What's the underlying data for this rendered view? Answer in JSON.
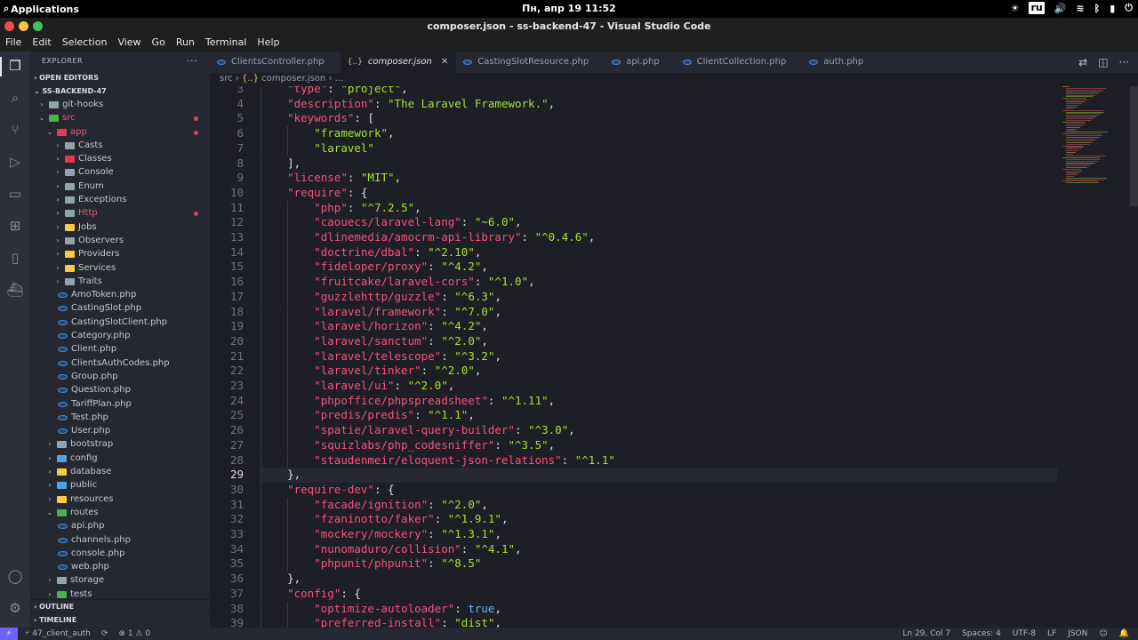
{
  "system": {
    "activities_label": "Applications",
    "clock": "Пн, апр 19  11:52",
    "keyboard_layout": "ru"
  },
  "window": {
    "title": "composer.json - ss-backend-47 - Visual Studio Code"
  },
  "menu": [
    "File",
    "Edit",
    "Selection",
    "View",
    "Go",
    "Run",
    "Terminal",
    "Help"
  ],
  "sidebar": {
    "title": "EXPLORER",
    "more": "···",
    "open_editors": "OPEN EDITORS",
    "project": "SS-BACKEND-47",
    "outline": "OUTLINE",
    "timeline": "TIMELINE",
    "tree": [
      {
        "label": "git-hooks",
        "depth": 0,
        "type": "folder",
        "open": false,
        "color": "#90a4ae"
      },
      {
        "label": "src",
        "depth": 0,
        "type": "folder",
        "open": true,
        "color": "#4caf50",
        "modified": true,
        "red": true
      },
      {
        "label": "app",
        "depth": 1,
        "type": "folder",
        "open": true,
        "color": "#e53950",
        "modified": true,
        "red": true
      },
      {
        "label": "Casts",
        "depth": 2,
        "type": "folder",
        "open": false,
        "color": "#90a4ae"
      },
      {
        "label": "Classes",
        "depth": 2,
        "type": "folder",
        "open": false,
        "color": "#e53950"
      },
      {
        "label": "Console",
        "depth": 2,
        "type": "folder",
        "open": false,
        "color": "#90a4ae"
      },
      {
        "label": "Enum",
        "depth": 2,
        "type": "folder",
        "open": false,
        "color": "#90a4ae"
      },
      {
        "label": "Exceptions",
        "depth": 2,
        "type": "folder",
        "open": false,
        "color": "#90a4ae"
      },
      {
        "label": "Http",
        "depth": 2,
        "type": "folder",
        "open": false,
        "color": "#90a4ae",
        "modified": true,
        "red": true
      },
      {
        "label": "Jobs",
        "depth": 2,
        "type": "folder",
        "open": false,
        "color": "#f9c846"
      },
      {
        "label": "Observers",
        "depth": 2,
        "type": "folder",
        "open": false,
        "color": "#90a4ae"
      },
      {
        "label": "Providers",
        "depth": 2,
        "type": "folder",
        "open": false,
        "color": "#f9c846"
      },
      {
        "label": "Services",
        "depth": 2,
        "type": "folder",
        "open": false,
        "color": "#f9c846"
      },
      {
        "label": "Traits",
        "depth": 2,
        "type": "folder",
        "open": false,
        "color": "#90a4ae"
      },
      {
        "label": "AmoToken.php",
        "depth": 2,
        "type": "php"
      },
      {
        "label": "CastingSlot.php",
        "depth": 2,
        "type": "php"
      },
      {
        "label": "CastingSlotClient.php",
        "depth": 2,
        "type": "php"
      },
      {
        "label": "Category.php",
        "depth": 2,
        "type": "php"
      },
      {
        "label": "Client.php",
        "depth": 2,
        "type": "php"
      },
      {
        "label": "ClientsAuthCodes.php",
        "depth": 2,
        "type": "php"
      },
      {
        "label": "Group.php",
        "depth": 2,
        "type": "php"
      },
      {
        "label": "Question.php",
        "depth": 2,
        "type": "php"
      },
      {
        "label": "TariffPlan.php",
        "depth": 2,
        "type": "php"
      },
      {
        "label": "Test.php",
        "depth": 2,
        "type": "php"
      },
      {
        "label": "User.php",
        "depth": 2,
        "type": "php"
      },
      {
        "label": "bootstrap",
        "depth": 1,
        "type": "folder",
        "open": false,
        "color": "#90a4ae"
      },
      {
        "label": "config",
        "depth": 1,
        "type": "folder",
        "open": false,
        "color": "#4fa3e0"
      },
      {
        "label": "database",
        "depth": 1,
        "type": "folder",
        "open": false,
        "color": "#f9c846"
      },
      {
        "label": "public",
        "depth": 1,
        "type": "folder",
        "open": false,
        "color": "#4fa3e0"
      },
      {
        "label": "resources",
        "depth": 1,
        "type": "folder",
        "open": false,
        "color": "#f9c846"
      },
      {
        "label": "routes",
        "depth": 1,
        "type": "folder",
        "open": true,
        "color": "#4caf50"
      },
      {
        "label": "api.php",
        "depth": 2,
        "type": "php"
      },
      {
        "label": "channels.php",
        "depth": 2,
        "type": "php"
      },
      {
        "label": "console.php",
        "depth": 2,
        "type": "php"
      },
      {
        "label": "web.php",
        "depth": 2,
        "type": "php"
      },
      {
        "label": "storage",
        "depth": 1,
        "type": "folder",
        "open": false,
        "color": "#90a4ae"
      },
      {
        "label": "tests",
        "depth": 1,
        "type": "folder",
        "open": false,
        "color": "#4caf50"
      }
    ]
  },
  "tabs": [
    {
      "label": "ClientsController.php",
      "kind": "php",
      "active": false
    },
    {
      "label": "composer.json",
      "kind": "json",
      "active": true
    },
    {
      "label": "CastingSlotResource.php",
      "kind": "php",
      "active": false
    },
    {
      "label": "api.php",
      "kind": "php",
      "active": false
    },
    {
      "label": "ClientCollection.php",
      "kind": "php",
      "active": false
    },
    {
      "label": "auth.php",
      "kind": "php",
      "active": false
    }
  ],
  "breadcrumb": {
    "folder": "src",
    "sep": "›",
    "json_icon": "{..}",
    "file": "composer.json",
    "more": "› ..."
  },
  "code": {
    "first_line": 3,
    "current_line": 29,
    "lines": [
      [
        [
          "i",
          4
        ],
        [
          "k",
          "\"type\""
        ],
        [
          "p",
          ": "
        ],
        [
          "s",
          "\"project\""
        ],
        [
          "p",
          ","
        ]
      ],
      [
        [
          "i",
          4
        ],
        [
          "k",
          "\"description\""
        ],
        [
          "p",
          ": "
        ],
        [
          "s",
          "\"The Laravel Framework.\""
        ],
        [
          "p",
          ","
        ]
      ],
      [
        [
          "i",
          4
        ],
        [
          "k",
          "\"keywords\""
        ],
        [
          "p",
          ": ["
        ]
      ],
      [
        [
          "i",
          8
        ],
        [
          "s",
          "\"framework\""
        ],
        [
          "p",
          ","
        ]
      ],
      [
        [
          "i",
          8
        ],
        [
          "s",
          "\"laravel\""
        ]
      ],
      [
        [
          "i",
          4
        ],
        [
          "p",
          "],"
        ]
      ],
      [
        [
          "i",
          4
        ],
        [
          "k",
          "\"license\""
        ],
        [
          "p",
          ": "
        ],
        [
          "s",
          "\"MIT\""
        ],
        [
          "p",
          ","
        ]
      ],
      [
        [
          "i",
          4
        ],
        [
          "k",
          "\"require\""
        ],
        [
          "p",
          ": {"
        ]
      ],
      [
        [
          "i",
          8
        ],
        [
          "k",
          "\"php\""
        ],
        [
          "p",
          ": "
        ],
        [
          "s",
          "\"^7.2.5\""
        ],
        [
          "p",
          ","
        ]
      ],
      [
        [
          "i",
          8
        ],
        [
          "k",
          "\"caouecs/laravel-lang\""
        ],
        [
          "p",
          ": "
        ],
        [
          "s",
          "\"~6.0\""
        ],
        [
          "p",
          ","
        ]
      ],
      [
        [
          "i",
          8
        ],
        [
          "k",
          "\"dlinemedia/amocrm-api-library\""
        ],
        [
          "p",
          ": "
        ],
        [
          "s",
          "\"^0.4.6\""
        ],
        [
          "p",
          ","
        ]
      ],
      [
        [
          "i",
          8
        ],
        [
          "k",
          "\"doctrine/dbal\""
        ],
        [
          "p",
          ": "
        ],
        [
          "s",
          "\"^2.10\""
        ],
        [
          "p",
          ","
        ]
      ],
      [
        [
          "i",
          8
        ],
        [
          "k",
          "\"fideloper/proxy\""
        ],
        [
          "p",
          ": "
        ],
        [
          "s",
          "\"^4.2\""
        ],
        [
          "p",
          ","
        ]
      ],
      [
        [
          "i",
          8
        ],
        [
          "k",
          "\"fruitcake/laravel-cors\""
        ],
        [
          "p",
          ": "
        ],
        [
          "s",
          "\"^1.0\""
        ],
        [
          "p",
          ","
        ]
      ],
      [
        [
          "i",
          8
        ],
        [
          "k",
          "\"guzzlehttp/guzzle\""
        ],
        [
          "p",
          ": "
        ],
        [
          "s",
          "\"^6.3\""
        ],
        [
          "p",
          ","
        ]
      ],
      [
        [
          "i",
          8
        ],
        [
          "k",
          "\"laravel/framework\""
        ],
        [
          "p",
          ": "
        ],
        [
          "s",
          "\"^7.0\""
        ],
        [
          "p",
          ","
        ]
      ],
      [
        [
          "i",
          8
        ],
        [
          "k",
          "\"laravel/horizon\""
        ],
        [
          "p",
          ": "
        ],
        [
          "s",
          "\"^4.2\""
        ],
        [
          "p",
          ","
        ]
      ],
      [
        [
          "i",
          8
        ],
        [
          "k",
          "\"laravel/sanctum\""
        ],
        [
          "p",
          ": "
        ],
        [
          "s",
          "\"^2.0\""
        ],
        [
          "p",
          ","
        ]
      ],
      [
        [
          "i",
          8
        ],
        [
          "k",
          "\"laravel/telescope\""
        ],
        [
          "p",
          ": "
        ],
        [
          "s",
          "\"^3.2\""
        ],
        [
          "p",
          ","
        ]
      ],
      [
        [
          "i",
          8
        ],
        [
          "k",
          "\"laravel/tinker\""
        ],
        [
          "p",
          ": "
        ],
        [
          "s",
          "\"^2.0\""
        ],
        [
          "p",
          ","
        ]
      ],
      [
        [
          "i",
          8
        ],
        [
          "k",
          "\"laravel/ui\""
        ],
        [
          "p",
          ": "
        ],
        [
          "s",
          "\"^2.0\""
        ],
        [
          "p",
          ","
        ]
      ],
      [
        [
          "i",
          8
        ],
        [
          "k",
          "\"phpoffice/phpspreadsheet\""
        ],
        [
          "p",
          ": "
        ],
        [
          "s",
          "\"^1.11\""
        ],
        [
          "p",
          ","
        ]
      ],
      [
        [
          "i",
          8
        ],
        [
          "k",
          "\"predis/predis\""
        ],
        [
          "p",
          ": "
        ],
        [
          "s",
          "\"^1.1\""
        ],
        [
          "p",
          ","
        ]
      ],
      [
        [
          "i",
          8
        ],
        [
          "k",
          "\"spatie/laravel-query-builder\""
        ],
        [
          "p",
          ": "
        ],
        [
          "s",
          "\"^3.0\""
        ],
        [
          "p",
          ","
        ]
      ],
      [
        [
          "i",
          8
        ],
        [
          "k",
          "\"squizlabs/php_codesniffer\""
        ],
        [
          "p",
          ": "
        ],
        [
          "s",
          "\"^3.5\""
        ],
        [
          "p",
          ","
        ]
      ],
      [
        [
          "i",
          8
        ],
        [
          "k",
          "\"staudenmeir/eloquent-json-relations\""
        ],
        [
          "p",
          ": "
        ],
        [
          "s",
          "\"^1.1\""
        ]
      ],
      [
        [
          "i",
          4
        ],
        [
          "p",
          "},"
        ]
      ],
      [
        [
          "i",
          4
        ],
        [
          "k",
          "\"require-dev\""
        ],
        [
          "p",
          ": {"
        ]
      ],
      [
        [
          "i",
          8
        ],
        [
          "k",
          "\"facade/ignition\""
        ],
        [
          "p",
          ": "
        ],
        [
          "s",
          "\"^2.0\""
        ],
        [
          "p",
          ","
        ]
      ],
      [
        [
          "i",
          8
        ],
        [
          "k",
          "\"fzaninotto/faker\""
        ],
        [
          "p",
          ": "
        ],
        [
          "s",
          "\"^1.9.1\""
        ],
        [
          "p",
          ","
        ]
      ],
      [
        [
          "i",
          8
        ],
        [
          "k",
          "\"mockery/mockery\""
        ],
        [
          "p",
          ": "
        ],
        [
          "s",
          "\"^1.3.1\""
        ],
        [
          "p",
          ","
        ]
      ],
      [
        [
          "i",
          8
        ],
        [
          "k",
          "\"nunomaduro/collision\""
        ],
        [
          "p",
          ": "
        ],
        [
          "s",
          "\"^4.1\""
        ],
        [
          "p",
          ","
        ]
      ],
      [
        [
          "i",
          8
        ],
        [
          "k",
          "\"phpunit/phpunit\""
        ],
        [
          "p",
          ": "
        ],
        [
          "s",
          "\"^8.5\""
        ]
      ],
      [
        [
          "i",
          4
        ],
        [
          "p",
          "},"
        ]
      ],
      [
        [
          "i",
          4
        ],
        [
          "k",
          "\"config\""
        ],
        [
          "p",
          ": {"
        ]
      ],
      [
        [
          "i",
          8
        ],
        [
          "k",
          "\"optimize-autoloader\""
        ],
        [
          "p",
          ": "
        ],
        [
          "b",
          "true"
        ],
        [
          "p",
          ","
        ]
      ],
      [
        [
          "i",
          8
        ],
        [
          "k",
          "\"preferred-install\""
        ],
        [
          "p",
          ": "
        ],
        [
          "s",
          "\"dist\""
        ],
        [
          "p",
          ","
        ]
      ]
    ]
  },
  "statusbar": {
    "branch": "47_client_auth",
    "sync": "⟳",
    "problems": "⊗ 1 ⚠ 0",
    "position": "Ln 29, Col 7",
    "spaces": "Spaces: 4",
    "encoding": "UTF-8",
    "eol": "LF",
    "language": "JSON"
  },
  "colors": {
    "key": "#f7527a",
    "string": "#a6e22e",
    "boolean": "#66b6ff",
    "accent": "#6c63ff"
  }
}
